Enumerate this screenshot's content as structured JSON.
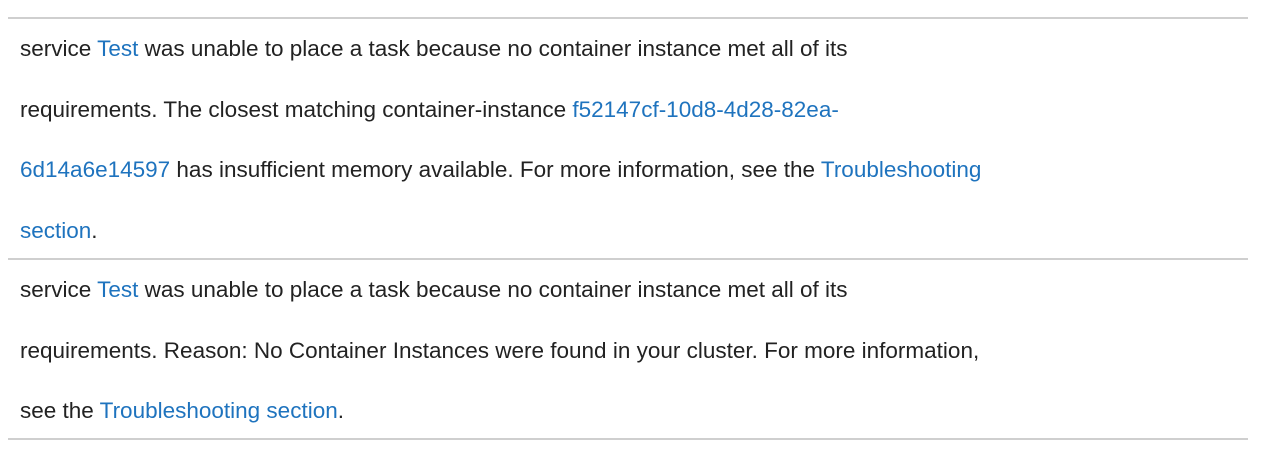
{
  "events": [
    {
      "lines": [
        [
          {
            "t": "service "
          },
          {
            "t": "Test",
            "link": true,
            "name": "service-link"
          },
          {
            "t": " was unable to place a task because no container instance met all of its"
          }
        ],
        [
          {
            "t": "requirements. The closest matching container-instance "
          },
          {
            "t": "f52147cf-10d8-4d28-82ea-",
            "link": true,
            "name": "container-instance-link"
          }
        ],
        [
          {
            "t": "6d14a6e14597",
            "link": true,
            "name": "container-instance-link"
          },
          {
            "t": " has insufficient memory available. For more information, see the "
          },
          {
            "t": "Troubleshooting",
            "link": true,
            "name": "troubleshooting-link"
          }
        ],
        [
          {
            "t": "section",
            "link": true,
            "name": "troubleshooting-link"
          },
          {
            "t": "."
          }
        ]
      ]
    },
    {
      "lines": [
        [
          {
            "t": "service "
          },
          {
            "t": "Test",
            "link": true,
            "name": "service-link"
          },
          {
            "t": " was unable to place a task because no container instance met all of its"
          }
        ],
        [
          {
            "t": "requirements. Reason: No Container Instances were found in your cluster. For more information,"
          }
        ],
        [
          {
            "t": "see the "
          },
          {
            "t": "Troubleshooting section",
            "link": true,
            "name": "troubleshooting-link"
          },
          {
            "t": "."
          }
        ]
      ]
    }
  ],
  "colors": {
    "text": "#222222",
    "link": "#1e73be",
    "divider": "#cfcfcf"
  }
}
